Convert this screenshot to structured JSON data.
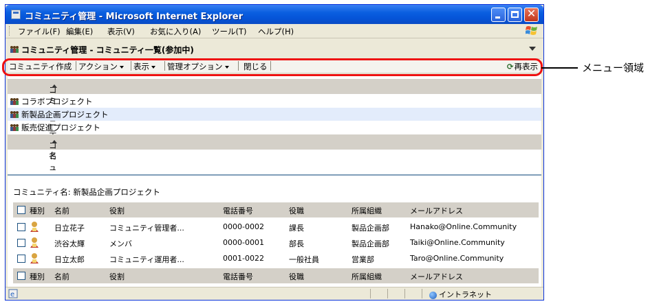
{
  "window": {
    "title": "コミュニティ管理 - Microsoft Internet Explorer"
  },
  "menubar": {
    "items": [
      "ファイル(F)",
      "編集(E)",
      "表示(V)",
      "お気に入り(A)",
      "ツール(T)",
      "ヘルプ(H)"
    ]
  },
  "page_header": {
    "title": "コミュニティ管理 - コミュニティ一覧(参加中)"
  },
  "toolbar": {
    "create": "コミュニティ作成",
    "action": "アクション",
    "view": "表示",
    "admin_options": "管理オプション",
    "close": "閉じる",
    "refresh": "再表示"
  },
  "community_list": {
    "column_header": "コミュニティ名",
    "items": [
      {
        "name": "コラボプロジェクト",
        "selected": false
      },
      {
        "name": "新製品企画プロジェクト",
        "selected": true
      },
      {
        "name": "販売促進プロジェクト",
        "selected": false
      }
    ],
    "footer_header": "コミュニティ名"
  },
  "detail": {
    "community_label": "コミュニティ名: 新製品企画プロジェクト",
    "columns": [
      "種別",
      "名前",
      "役割",
      "電話番号",
      "役職",
      "所属組織",
      "メールアドレス"
    ],
    "rows": [
      {
        "name": "日立花子",
        "role": "コミュニティ管理者...",
        "phone": "0000-0002",
        "title": "課長",
        "org": "製品企画部",
        "email": "Hanako@Online.Community"
      },
      {
        "name": "渋谷太輝",
        "role": "メンバ",
        "phone": "0000-0001",
        "title": "部長",
        "org": "製品企画部",
        "email": "Taiki@Online.Community"
      },
      {
        "name": "日立太郎",
        "role": "コミュニティ運用者...",
        "phone": "0001-0022",
        "title": "一般社員",
        "org": "営業部",
        "email": "Taro@Online.Community"
      }
    ]
  },
  "statusbar": {
    "zone": "イントラネット"
  },
  "annotation": {
    "label": "メニュー領域",
    "color": "#ee1111"
  }
}
